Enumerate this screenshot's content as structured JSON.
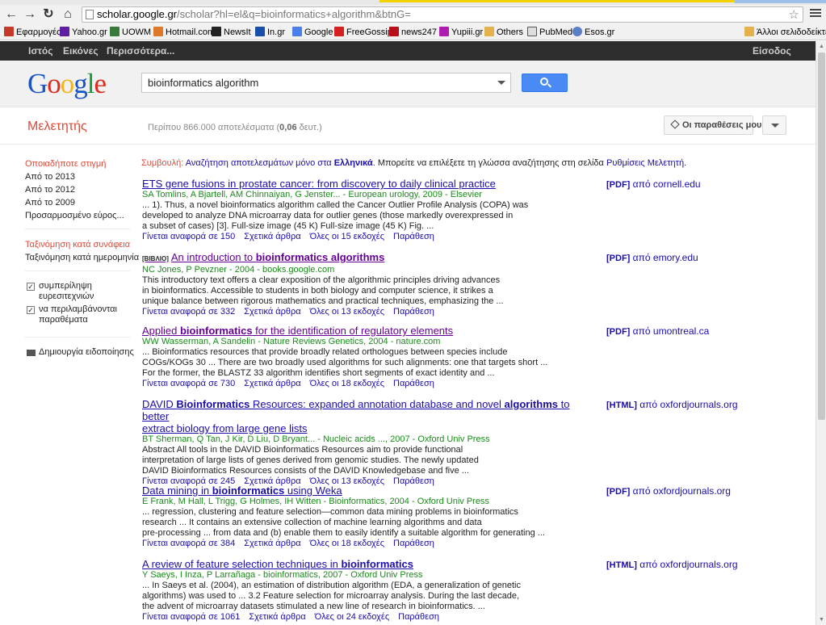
{
  "browser": {
    "url_main": "scholar.google.gr",
    "url_rest": "/scholar?hl=el&q=bioinformatics+algorithm&btnG=",
    "bookmarks": [
      "Εφαρμογές",
      "Yahoo.gr",
      "UOWM",
      "Hotmail.com",
      "NewsIt",
      "In.gr",
      "Google",
      "FreeGossip",
      "news247",
      "Yupiii.gr",
      "Others",
      "PubMed",
      "Esos.gr"
    ],
    "other_bookmarks": "Άλλοι σελιδοδείκτες"
  },
  "gbar": {
    "web": "Ιστός",
    "images": "Εικόνες",
    "more": "Περισσότερα...",
    "signin": "Είσοδος"
  },
  "logo": {
    "l1": "G",
    "l2": "o",
    "l3": "o",
    "l4": "g",
    "l5": "l",
    "l6": "e"
  },
  "search": {
    "query": "bioinformatics algorithm"
  },
  "scholar": {
    "title": "Μελετητής",
    "stats_pre": "Περίπου 866.000 αποτελέσματα (",
    "stats_time": "0,06",
    "stats_post": " δευτ.)",
    "my_citations": "Οι παραθέσεις μου"
  },
  "sidebar": {
    "anytime": "Οποιαδήποτε στιγμή",
    "since2013": "Από το 2013",
    "since2012": "Από το 2012",
    "since2009": "Από το 2009",
    "custom": "Προσαρμοσμένο εύρος...",
    "sort_relevance": "Ταξινόμηση κατά συνάφεια",
    "sort_date": "Ταξινόμηση κατά ημερομηνία",
    "patents_1": "συμπερίληψη",
    "patents_2": "ευρεσιτεχνιών",
    "citations_1": "να περιλαμβάνονται",
    "citations_2": "παραθέματα",
    "alert": "Δημιουργία ειδοποίησης"
  },
  "tip": {
    "label": "Συμβουλή:",
    "link": "Αναζήτηση αποτελεσμάτων μόνο στα",
    "lang": "Ελληνικά",
    "mid": ". Μπορείτε να επιλέξετε τη γλώσσα αναζήτησης στη σελίδα",
    "settings": "Ρυθμίσεις Μελετητή",
    "end": "."
  },
  "results": [
    {
      "title": "ETS gene fusions in prostate cancer: from discovery to daily clinical practice",
      "authors": "SA Tomlins, A Bjartell, AM Chinnaiyan, G Jenster... - European urology, 2009 - Elsevier",
      "snippet_lines": [
        "... 1). Thus, a novel bioinformatics algorithm called the Cancer Outlier Profile Analysis (COPA) was",
        "developed to analyze DNA microarray data for outlier genes (those markedly overexpressed in",
        "a subset of cases) [3]. Full-size image (45 K) Full-size image (45 K) Fig. ..."
      ],
      "cited": "Γίνεται αναφορά σε 150",
      "related": "Σχετικά άρθρα",
      "versions": "Όλες οι 15 εκδοχές",
      "cite": "Παράθεση",
      "side_type": "[PDF]",
      "side_src": "από cornell.edu"
    },
    {
      "tag": "[ΒΙΒΛΙΟ]",
      "title_pre": "An introduction to ",
      "title_bold": "bioinformatics algorithms",
      "authors": "NC Jones, P Pevzner - 2004 - books.google.com",
      "snippet_lines": [
        "This introductory text offers a clear exposition of the algorithmic principles driving advances",
        "in bioinformatics. Accessible to students in both biology and computer science, it strikes a",
        "unique balance between rigorous mathematics and practical techniques, emphasizing the ..."
      ],
      "cited": "Γίνεται αναφορά σε 332",
      "related": "Σχετικά άρθρα",
      "versions": "Όλες οι 13 εκδοχές",
      "cite": "Παράθεση",
      "side_type": "[PDF]",
      "side_src": "από emory.edu"
    },
    {
      "title_pre": "Applied ",
      "title_bold": "bioinformatics",
      "title_post": " for the identification of regulatory elements",
      "authors": "WW Wasserman, A Sandelin - Nature Reviews Genetics, 2004 - nature.com",
      "snippet_lines": [
        "... Bioinformatics resources that provide broadly related orthologues between species include",
        "COGs/KOGs 30 ... There are two broadly used algorithms for such alignments: one that targets short ...",
        "For the former, the BLASTZ 33 algorithm identifies short segments of exact identity and ..."
      ],
      "cited": "Γίνεται αναφορά σε 730",
      "related": "Σχετικά άρθρα",
      "versions": "Όλες οι 18 εκδοχές",
      "cite": "Παράθεση",
      "side_type": "[PDF]",
      "side_src": "από umontreal.ca"
    },
    {
      "title_l1_pre": "DAVID ",
      "title_l1_b1": "Bioinformatics",
      "title_l1_mid": " Resources: expanded annotation database and novel ",
      "title_l1_b2": "algorithms",
      "title_l1_post": " to better",
      "title_l2": "extract biology from large gene lists",
      "authors": "BT Sherman, Q Tan, J Kir, D Liu, D Bryant... - Nucleic acids ..., 2007 - Oxford Univ Press",
      "snippet_lines": [
        "Abstract All tools in the DAVID Bioinformatics Resources aim to provide functional",
        "interpretation of large lists of genes derived from genomic studies. The newly updated",
        "DAVID Bioinformatics Resources consists of the DAVID Knowledgebase and five ..."
      ],
      "cited": "Γίνεται αναφορά σε 245",
      "related": "Σχετικά άρθρα",
      "versions": "Όλες οι 13 εκδοχές",
      "cite": "Παράθεση",
      "side_type": "[HTML]",
      "side_src": "από oxfordjournals.org"
    },
    {
      "title_pre": "Data mining in ",
      "title_bold": "bioinformatics",
      "title_post": " using Weka",
      "authors": "E Frank, M Hall, L Trigg, G Holmes, IH Witten - Bioinformatics, 2004 - Oxford Univ Press",
      "snippet_lines": [
        "... regression, clustering and feature selection—common data mining problems in bioinformatics",
        "research ... It contains an extensive collection of machine learning algorithms and data",
        "pre-processing ... from data and (b) enable them to easily identify a suitable algorithm for generating ..."
      ],
      "cited": "Γίνεται αναφορά σε 384",
      "related": "Σχετικά άρθρα",
      "versions": "Όλες οι 18 εκδοχές",
      "cite": "Παράθεση",
      "side_type": "[PDF]",
      "side_src": "από oxfordjournals.org"
    },
    {
      "title_pre": "A review of feature selection techniques in ",
      "title_bold": "bioinformatics",
      "authors": "Y Saeys, I Inza, P Larrañaga - bioinformatics, 2007 - Oxford Univ Press",
      "snippet_lines": [
        "... In Saeys et al. (2004), an estimation of distribution algorithm (EDA, a generalization of genetic",
        "algorithms) was used to ... 3.2 Feature selection for microarray analysis. During the last decade,",
        "the advent of microarray datasets stimulated a new line of research in bioinformatics. ..."
      ],
      "cited": "Γίνεται αναφορά σε 1061",
      "related": "Σχετικά άρθρα",
      "versions": "Όλες οι 24 εκδοχές",
      "cite": "Παράθεση",
      "side_type": "[HTML]",
      "side_src": "από oxfordjournals.org"
    }
  ]
}
